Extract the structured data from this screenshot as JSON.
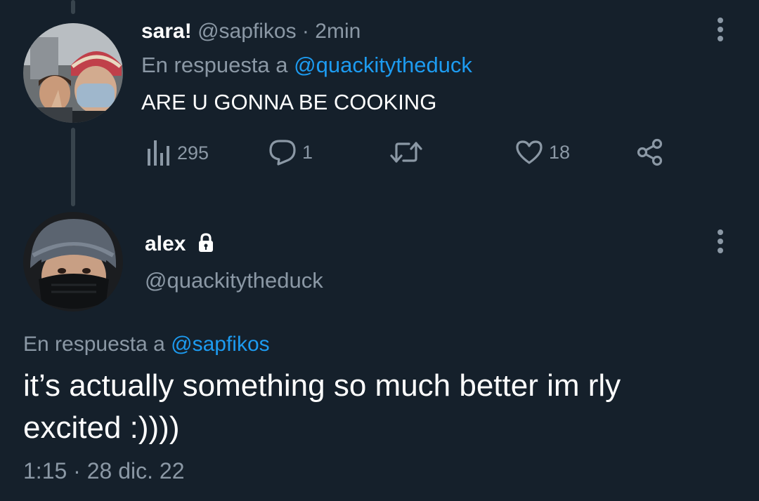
{
  "reply_tweet": {
    "display_name": "sara!",
    "handle": "@sapfikos",
    "separator": "·",
    "time": "2min",
    "reply_prefix": "En respuesta a",
    "reply_to": "@quackitytheduck",
    "text": "ARE U GONNA BE COOKING",
    "actions": {
      "views": "295",
      "replies": "1",
      "retweets": "",
      "likes": "18"
    }
  },
  "main_tweet": {
    "display_name": "alex",
    "handle": "@quackitytheduck",
    "reply_prefix": "En respuesta a",
    "reply_to": "@sapfikos",
    "text_line1": "it’s actually something so much better im rly",
    "text_line2": "excited :))))",
    "time": "1:15",
    "separator": "·",
    "date": "28 dic. 22"
  },
  "colors": {
    "background": "#15202b",
    "text": "#ffffff",
    "muted": "#8b98a5",
    "link": "#1d9bf0",
    "thread_line": "#38444d"
  },
  "icons": [
    "views-icon",
    "reply-icon",
    "retweet-icon",
    "like-icon",
    "share-icon",
    "lock-icon",
    "more-icon"
  ]
}
